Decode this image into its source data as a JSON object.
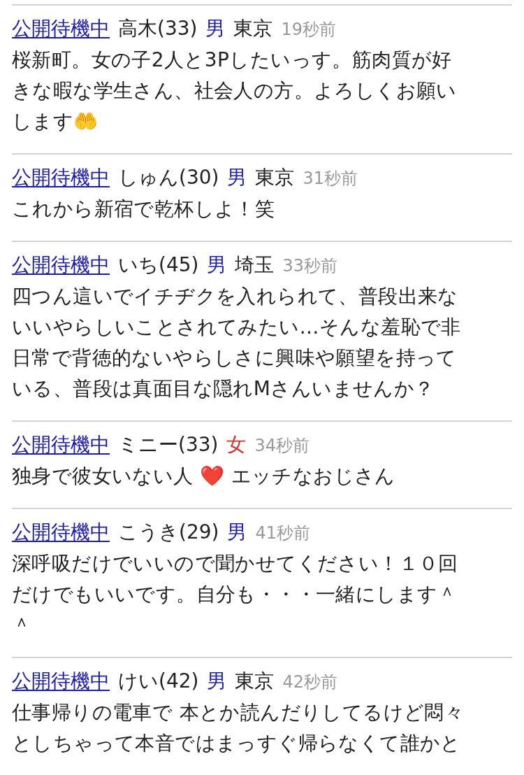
{
  "posts": [
    {
      "status": "公開待機中",
      "name": "高木(33)",
      "gender": {
        "label": "男",
        "color": "#2020a8"
      },
      "location": "東京",
      "time": "19秒前",
      "message_lines": [
        "桜新町。女の子2人と3Pしたいっす。筋肉質が好",
        "きな暇な学生さん、社会人の方。よろしくお願い",
        "します🤲"
      ]
    },
    {
      "status": "公開待機中",
      "name": "しゅん(30)",
      "gender": {
        "label": "男",
        "color": "#2020a8"
      },
      "location": "東京",
      "time": "31秒前",
      "message_lines": [
        "これから新宿で乾杯しよ！笑"
      ]
    },
    {
      "status": "公開待機中",
      "name": "いち(45)",
      "gender": {
        "label": "男",
        "color": "#2020a8"
      },
      "location": "埼玉",
      "time": "33秒前",
      "message_lines": [
        "四つん這いでイチヂクを入れられて、普段出来な",
        "いいやらしいことされてみたい…そんな羞恥で非",
        "日常で背徳的ないやらしさに興味や願望を持って",
        "いる、普段は真面目な隠れMさんいませんか？"
      ]
    },
    {
      "status": "公開待機中",
      "name": "ミニー(33)",
      "gender": {
        "label": "女",
        "color": "#d03030"
      },
      "time": "34秒前",
      "message_lines": [
        "独身で彼女いない人 ❤️ エッチなおじさん"
      ]
    },
    {
      "status": "公開待機中",
      "name": "こうき(29)",
      "gender": {
        "label": "男",
        "color": "#2020a8"
      },
      "time": "41秒前",
      "message_lines": [
        "深呼吸だけでいいので聞かせてください！１０回",
        "だけでもいいです。自分も・・・一緒にします＾",
        "＾"
      ]
    },
    {
      "status": "公開待機中",
      "name": "けい(42)",
      "gender": {
        "label": "男",
        "color": "#2020a8"
      },
      "location": "東京",
      "time": "42秒前",
      "message_lines": [
        "仕事帰りの電車で 本とか読んだりしてるけど悶々",
        "としちゃって本音ではまっすぐ帰らなくて誰かと"
      ]
    }
  ]
}
